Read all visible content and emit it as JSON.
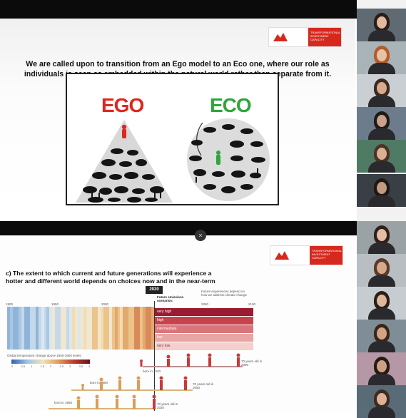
{
  "slide1": {
    "brand_text": "TRANSFORMATIONAL INVESTMENT CAPACITY",
    "heading_line1": "We are called upon to transition from an Ego model to an Eco one, where our role as",
    "heading_line2": "individuals is seen as embedded within the natural world rather than separate from it.",
    "ego_label": "EGO",
    "eco_label": "ECO"
  },
  "slide2": {
    "brand_text": "TRANSFORMATIONAL INVESTMENT CAPACITY",
    "question_line1": "c) The extent to which current and future generations will experience a",
    "question_line2": "hotter and different world depends on choices now and in the near-term",
    "year_marker": "2020",
    "future_header": "Future emissions scenarios:",
    "scenarios": [
      "very high",
      "high",
      "intermediate",
      "low",
      "very low"
    ],
    "axis_years": [
      "1900",
      "1950",
      "2000",
      "2050",
      "2100"
    ],
    "legend_title": "Global temperature change above 1850-1900 levels",
    "legend_ticks": [
      "0",
      "0.5",
      "1",
      "1.5",
      "2",
      "2.5",
      "3",
      "3.5",
      "4"
    ],
    "born_labels": [
      "born in 2020",
      "born in 1980",
      "born in 1950"
    ],
    "age_labels": [
      "70 years old in 2090",
      "70 years old in 2050",
      "70 years old in 2020"
    ],
    "note_text": "Future experiences depend on how we address climate change"
  },
  "meeting": {
    "close_glyph": "×",
    "participants": 12
  },
  "colors": {
    "ego_red": "#e0261f",
    "eco_green": "#2fa63a",
    "brand_red": "#d7281e",
    "scenario_colors": [
      "#9b1b30",
      "#c8424b",
      "#d9757a",
      "#e9a5a4",
      "#f4cfcb"
    ]
  }
}
